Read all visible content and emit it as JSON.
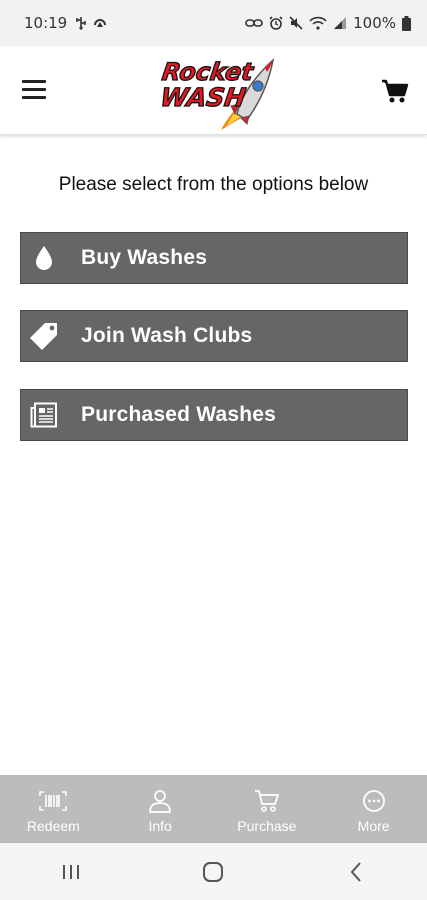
{
  "status_bar": {
    "time": "10:19",
    "battery": "100%"
  },
  "header": {
    "logo_text_top": "Rocket",
    "logo_text_bottom": "WASH",
    "brand_color": "#e01b24"
  },
  "main": {
    "prompt": "Please select from the options below",
    "options": [
      {
        "label": "Buy Washes",
        "icon": "drop-icon"
      },
      {
        "label": "Join Wash Clubs",
        "icon": "tag-icon"
      },
      {
        "label": "Purchased Washes",
        "icon": "receipt-icon"
      }
    ],
    "button_color": "#666666"
  },
  "bottom_nav": {
    "items": [
      {
        "label": "Redeem",
        "icon": "barcode-icon"
      },
      {
        "label": "Info",
        "icon": "person-icon"
      },
      {
        "label": "Purchase",
        "icon": "cart-icon"
      },
      {
        "label": "More",
        "icon": "more-icon"
      }
    ]
  },
  "system_nav": {
    "buttons": [
      "recents",
      "home",
      "back"
    ]
  }
}
